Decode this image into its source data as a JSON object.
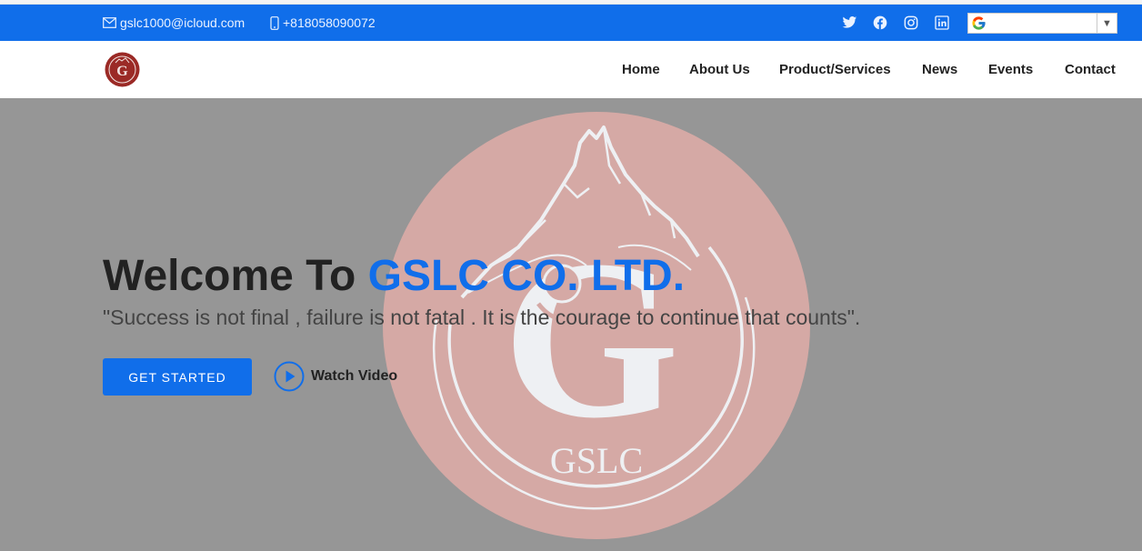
{
  "topbar": {
    "email": "gslc1000@icloud.com",
    "phone": "+818058090072",
    "social_icons": [
      "twitter-icon",
      "facebook-icon",
      "instagram-icon",
      "linkedin-icon"
    ],
    "translate_widget": {
      "logo": "google-icon",
      "selected": "",
      "arrow": "▼"
    }
  },
  "navbar": {
    "logo_letter": "G",
    "items": [
      {
        "label": "Home"
      },
      {
        "label": "About Us"
      },
      {
        "label": "Product/Services"
      },
      {
        "label": "News"
      },
      {
        "label": "Events"
      },
      {
        "label": "Contact"
      }
    ]
  },
  "hero": {
    "title_prefix": "Welcome To ",
    "title_accent": "GSLC CO. LTD.",
    "quote": "\"Success is not final , failure is not fatal . It is the courage to continue that counts\".",
    "primary_button": "GET STARTED",
    "video_link": "Watch Video",
    "emblem_text": "GSLC",
    "emblem_letter": "G"
  },
  "colors": {
    "brand_blue": "#106eea",
    "hero_bg": "#969696",
    "emblem": "#d5a9a5",
    "logo_red": "#9b2a26",
    "text_dark": "#222222"
  }
}
